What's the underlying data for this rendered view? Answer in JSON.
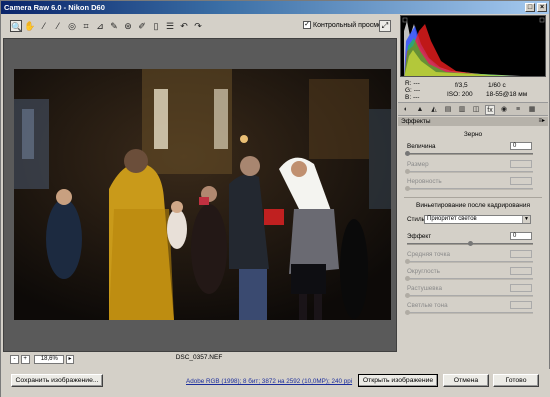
{
  "window": {
    "title": "Camera Raw 6.0  -  Nikon D60"
  },
  "toolbar": {
    "tools": [
      {
        "icon": "zoom-icon",
        "glyph": "🔍"
      },
      {
        "icon": "hand-icon",
        "glyph": "✋"
      },
      {
        "icon": "white-balance-icon",
        "glyph": "⁄"
      },
      {
        "icon": "color-sampler-icon",
        "glyph": "⁄"
      },
      {
        "icon": "target-adjust-icon",
        "glyph": "◎"
      },
      {
        "icon": "crop-icon",
        "glyph": "⌗"
      },
      {
        "icon": "straighten-icon",
        "glyph": "⊿"
      },
      {
        "icon": "spot-removal-icon",
        "glyph": "✎"
      },
      {
        "icon": "red-eye-icon",
        "glyph": "⊛"
      },
      {
        "icon": "adjustment-brush-icon",
        "glyph": "✐"
      },
      {
        "icon": "graduated-filter-icon",
        "glyph": "▯"
      },
      {
        "icon": "preferences-icon",
        "glyph": "☰"
      },
      {
        "icon": "rotate-left-icon",
        "glyph": "↶"
      },
      {
        "icon": "rotate-right-icon",
        "glyph": "↷"
      }
    ],
    "preview_label": "Контрольный просмотр",
    "preview_checked": "✓"
  },
  "readout": {
    "r_label": "R:",
    "g_label": "G:",
    "b_label": "B:",
    "r_val": "---",
    "g_val": "---",
    "b_val": "---",
    "aperture": "f/3,5",
    "shutter": "1/60 с",
    "iso": "ISO: 200",
    "lens": "18-55@18 мм"
  },
  "tabs": {
    "icons": [
      "basic-icon",
      "tone-curve-icon",
      "detail-icon",
      "hsl-icon",
      "split-toning-icon",
      "lens-icon",
      "effects-icon",
      "calibration-icon",
      "presets-icon",
      "snapshots-icon"
    ],
    "glyphs": [
      "◐",
      "▲",
      "◭",
      "▤",
      "▥",
      "◫",
      "fx",
      "◉",
      "≡",
      "▦"
    ],
    "active_index": 6
  },
  "panel": {
    "header": "Эффекты",
    "grain": {
      "title": "Зерно",
      "amount_label": "Величина",
      "amount_value": "0",
      "size_label": "Размер",
      "roughness_label": "Неровность"
    },
    "vignette": {
      "title": "Виньетирование после кадрирования",
      "style_label": "Стиль:",
      "style_value": "Приоритет светов",
      "effect_label": "Эффект",
      "effect_value": "0",
      "effect_level": 0.5,
      "midpoint_label": "Средняя точка",
      "roundness_label": "Округлость",
      "feather_label": "Растушевка",
      "highlights_label": "Светлые тона"
    }
  },
  "status": {
    "zoom": "18,6%",
    "filename": "DSC_0357.NEF"
  },
  "footer": {
    "save_label": "Сохранить изображение...",
    "workflow_link": "Adobe RGB (1998); 8 бит; 3872 на 2592 (10,0MP); 240 ppi",
    "open_label": "Открыть изображение",
    "cancel_label": "Отмена",
    "done_label": "Готово"
  }
}
